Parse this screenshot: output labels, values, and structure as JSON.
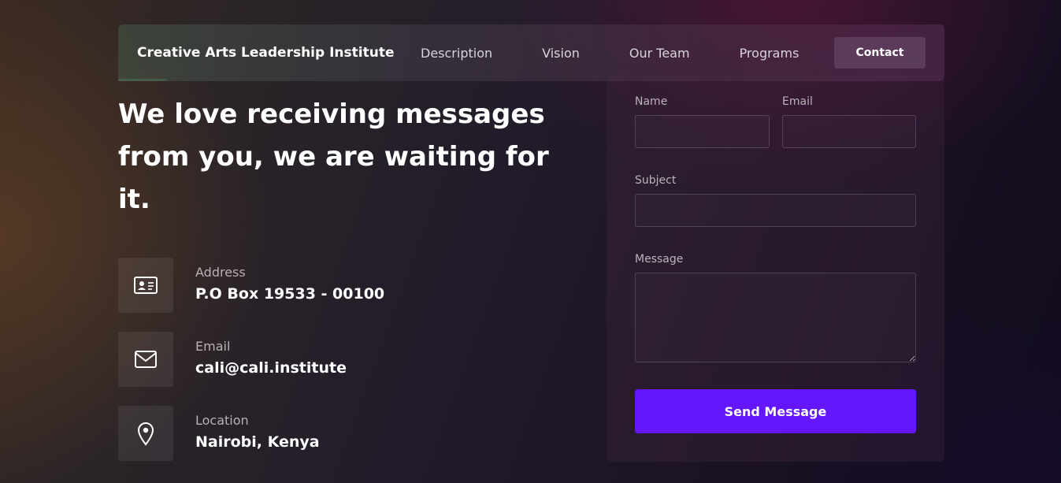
{
  "navbar": {
    "brand": "Creative Arts Leadership Institute",
    "links": [
      "Description",
      "Vision",
      "Our Team",
      "Programs"
    ],
    "contact_label": "Contact"
  },
  "hero": {
    "headline": "We love receiving messages from you, we are waiting for it."
  },
  "contact_info": [
    {
      "icon": "id-card-icon",
      "label": "Address",
      "value": "P.O Box 19533 - 00100"
    },
    {
      "icon": "mail-icon",
      "label": "Email",
      "value": "cali@cali.institute"
    },
    {
      "icon": "location-pin-icon",
      "label": "Location",
      "value": "Nairobi, Kenya"
    }
  ],
  "form": {
    "name_label": "Name",
    "name_value": "",
    "email_label": "Email",
    "email_value": "",
    "subject_label": "Subject",
    "subject_value": "",
    "message_label": "Message",
    "message_value": "",
    "submit_label": "Send Message"
  },
  "colors": {
    "button_primary": "#6417ff",
    "text_primary": "#ffffff",
    "text_muted": "#b9b0b4"
  }
}
